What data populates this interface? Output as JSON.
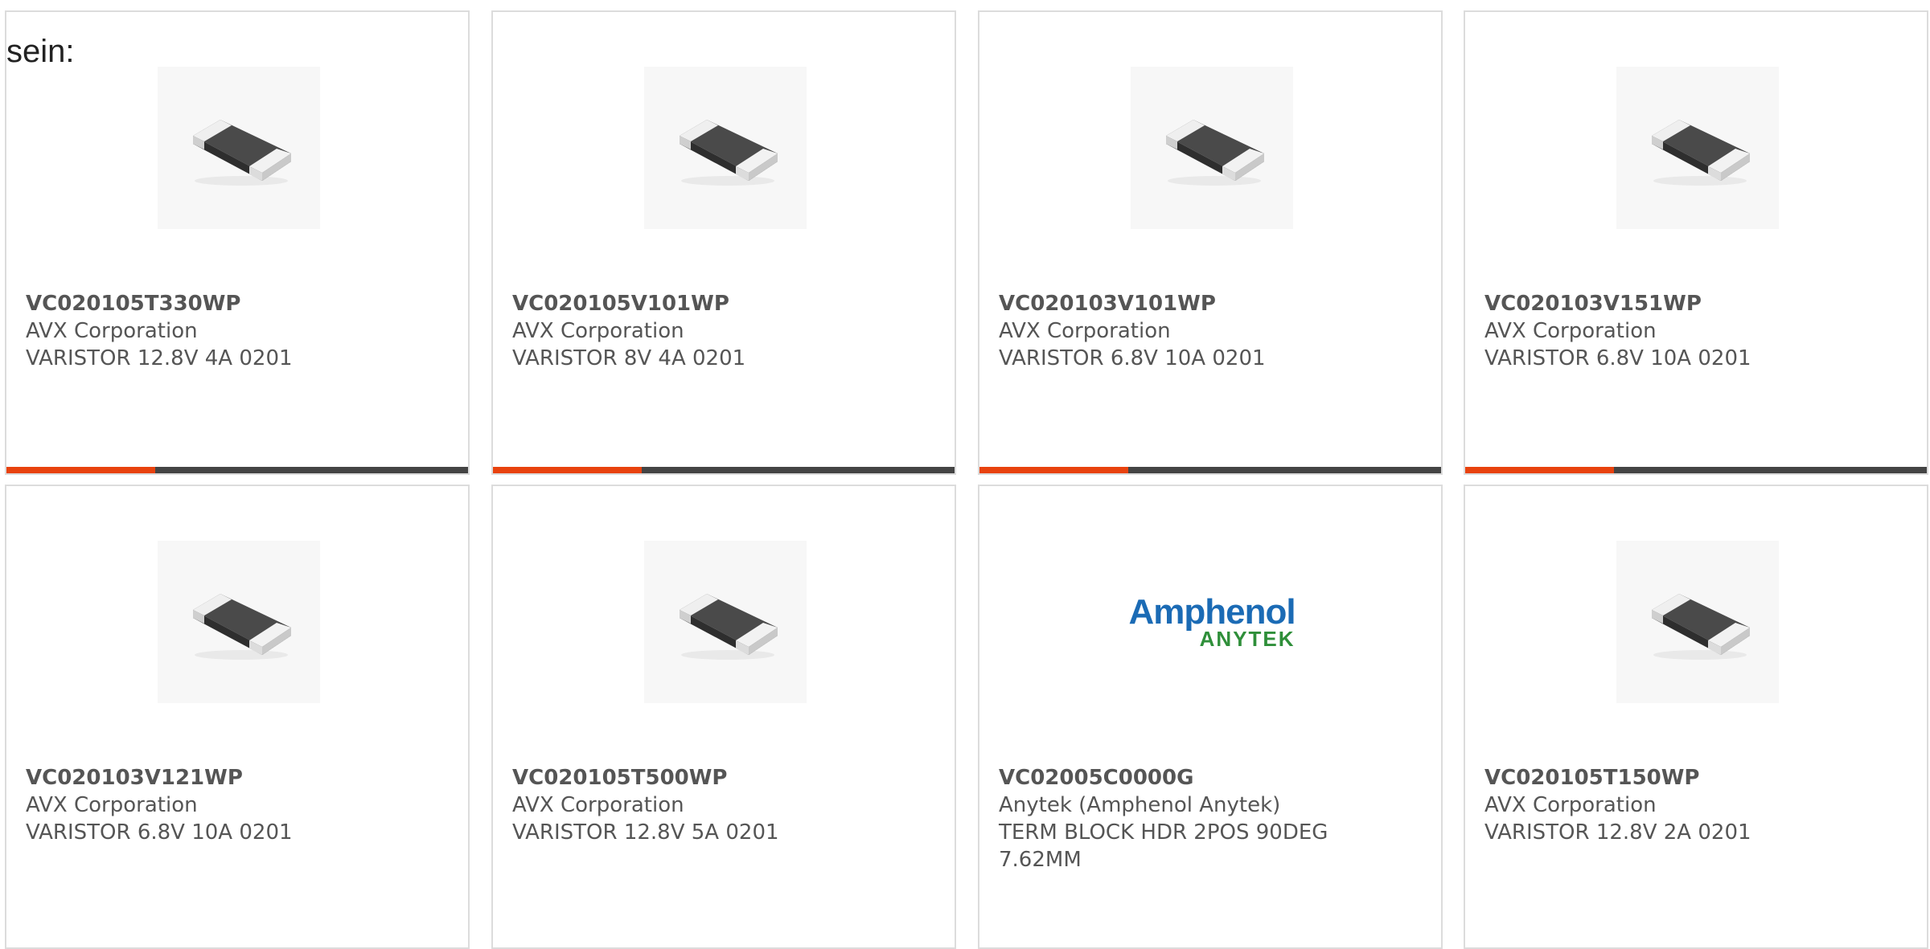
{
  "intro_text": "sein:",
  "colors": {
    "accent": "#e8420e",
    "bar_track": "#444444",
    "card_border": "#dcdcdc",
    "text": "#555555"
  },
  "products": [
    {
      "part": "VC020105T330WP",
      "manufacturer": "AVX Corporation",
      "description": "VARISTOR 12.8V 4A 0201",
      "image": "smd-chip-varistor",
      "rating_fraction": 0.32
    },
    {
      "part": "VC020105V101WP",
      "manufacturer": "AVX Corporation",
      "description": "VARISTOR 8V 4A 0201",
      "image": "smd-chip-varistor",
      "rating_fraction": 0.32
    },
    {
      "part": "VC020103V101WP",
      "manufacturer": "AVX Corporation",
      "description": "VARISTOR 6.8V 10A 0201",
      "image": "smd-chip-varistor",
      "rating_fraction": 0.32
    },
    {
      "part": "VC020103V151WP",
      "manufacturer": "AVX Corporation",
      "description": "VARISTOR 6.8V 10A 0201",
      "image": "smd-chip-varistor",
      "rating_fraction": 0.32
    },
    {
      "part": "VC020103V121WP",
      "manufacturer": "AVX Corporation",
      "description": "VARISTOR 6.8V 10A 0201",
      "image": "smd-chip-varistor"
    },
    {
      "part": "VC020105T500WP",
      "manufacturer": "AVX Corporation",
      "description": "VARISTOR 12.8V 5A 0201",
      "image": "smd-chip-varistor"
    },
    {
      "part": "VC02005C0000G",
      "manufacturer": "Anytek (Amphenol Anytek)",
      "description": "TERM BLOCK HDR 2POS 90DEG 7.62MM",
      "image": "amphenol-anytek-logo",
      "logo_line1": "Amphenol",
      "logo_line2": "ANYTEK"
    },
    {
      "part": "VC020105T150WP",
      "manufacturer": "AVX Corporation",
      "description": "VARISTOR 12.8V 2A 0201",
      "image": "smd-chip-varistor"
    }
  ]
}
